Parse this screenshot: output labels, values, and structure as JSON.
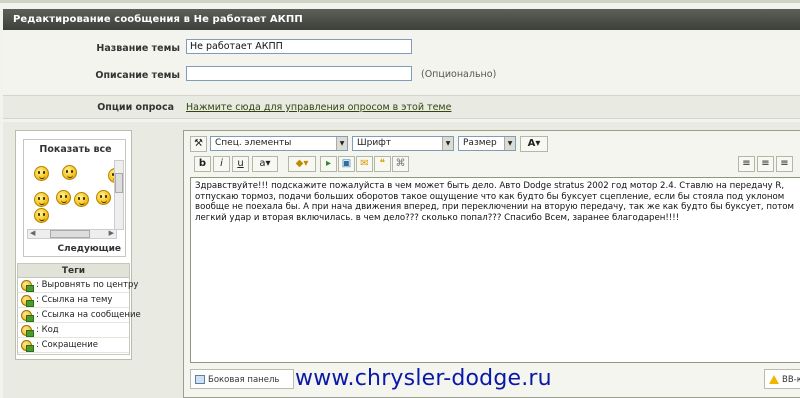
{
  "title": "Редактирование сообщения в Не работает АКПП",
  "form": {
    "topic_label": "Название темы",
    "topic_value": "Не работает АКПП",
    "desc_label": "Описание темы",
    "desc_value": "",
    "desc_hint": "(Опционально)"
  },
  "poll": {
    "label": "Опции опроса",
    "link": "Нажмите сюда для управления опросом в этой теме"
  },
  "emoticons": {
    "title": "Показать все",
    "next": "Следующие"
  },
  "tags": {
    "title": "Теги",
    "items": [
      ": Выровнять по центру",
      ": Ссылка на тему",
      ": Ссылка на сообщение",
      ": Код",
      ": Сокращение"
    ]
  },
  "toolbar": {
    "special": "Спец. элементы",
    "font": "Шрифт",
    "size": "Размер",
    "color_btn": "A",
    "bold": "b",
    "italic": "i",
    "underline": "u",
    "text_style": "a"
  },
  "editor_text": "Здравствуйте!!! подскажите пожалуйста в чем может быть дело. Авто Dodge stratus 2002 год мотор 2.4. Ставлю на передачу R, отпускаю тормоз, подачи больших оборотов такое ощущение что как будто бы буксует сцепление, если бы стояла под уклоном вообще не поехала бы. А при нача движения вперед, при переключении на вторую передачу, так же как будто бы буксует, потом легкий удар и вторая включилась. в чем дело??? сколько попал??? Спасибо Всем, заранее благодарен!!!!",
  "bottom": {
    "side_panel": "Боковая панель",
    "bb": "BB-ко"
  },
  "watermark": "www.chrysler-dodge.ru"
}
